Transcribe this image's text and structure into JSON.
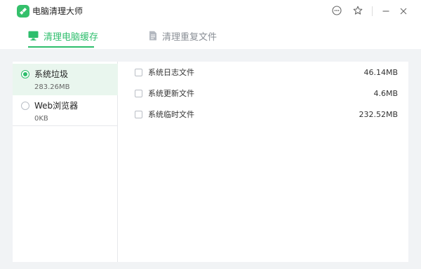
{
  "app": {
    "title": "电脑清理大师",
    "accent_color": "#2dbe6c",
    "logo_icon": "broom-icon"
  },
  "title_controls": {
    "feedback_icon": "chat-bubble-icon",
    "favorite_icon": "star-icon",
    "minimize_icon": "minimize-icon",
    "close_icon": "close-icon"
  },
  "tabs": [
    {
      "label": "清理电脑缓存",
      "icon": "monitor-icon",
      "active": true
    },
    {
      "label": "清理重复文件",
      "icon": "document-icon",
      "active": false
    }
  ],
  "categories": [
    {
      "label": "系统垃圾",
      "size": "283.26MB",
      "selected": true
    },
    {
      "label": "Web浏览器",
      "size": "0KB",
      "selected": false
    }
  ],
  "items": [
    {
      "label": "系统日志文件",
      "size": "46.14MB",
      "checked": false
    },
    {
      "label": "系统更新文件",
      "size": "4.6MB",
      "checked": false
    },
    {
      "label": "系统临时文件",
      "size": "232.52MB",
      "checked": false
    }
  ]
}
